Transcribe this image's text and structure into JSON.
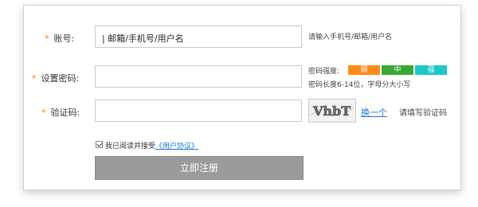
{
  "form": {
    "account": {
      "required_mark": "*",
      "label": "账号:",
      "value": "| 邮箱/手机号/用户名",
      "hint": "请输入手机号/邮箱/用户名"
    },
    "password": {
      "required_mark": "*",
      "label": "设置密码:",
      "value": "",
      "strength_label": "密码强度:",
      "strength_levels": [
        "弱",
        "中",
        "强"
      ],
      "hint": "密码长度6-14位，字母分大小写"
    },
    "captcha": {
      "required_mark": "*",
      "label": "验证码:",
      "value": "",
      "image_text": "VhbT",
      "refresh_link": "换一个",
      "hint": "请填写验证码"
    },
    "agreement": {
      "checked": true,
      "text": "我已阅读并接受",
      "link": "《用户协议》"
    },
    "submit_label": "立即注册"
  },
  "colors": {
    "required": "#ff7a1a",
    "weak": "#ff8c1a",
    "medium": "#3aa832",
    "strong": "#1ec8c8",
    "link": "#1976d2",
    "submit_bg": "#9b9b9b"
  }
}
